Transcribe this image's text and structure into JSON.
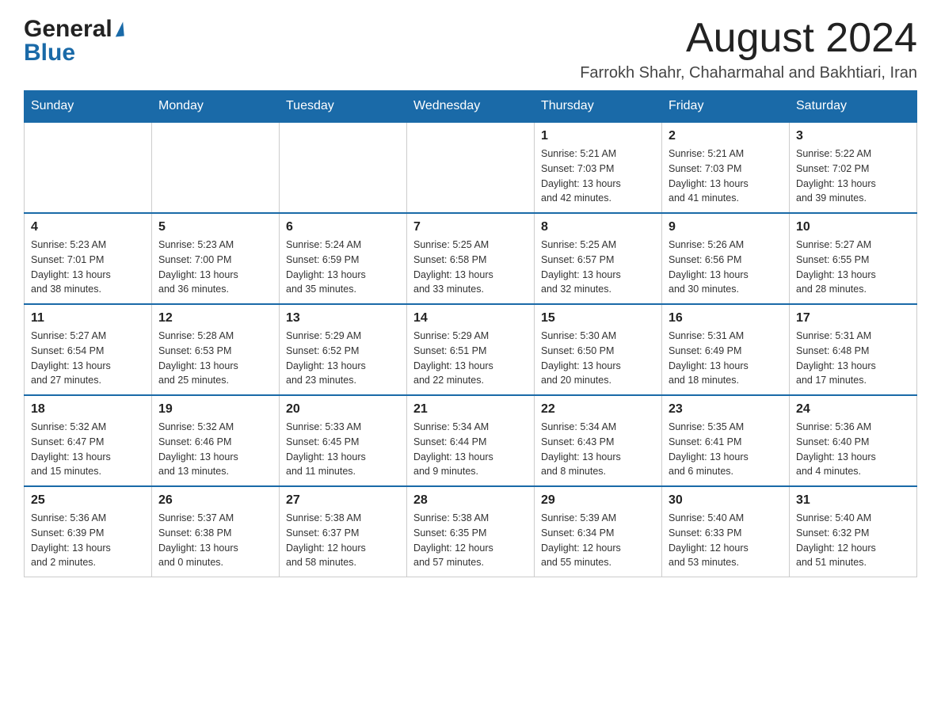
{
  "logo": {
    "general": "General",
    "blue": "Blue"
  },
  "title": "August 2024",
  "subtitle": "Farrokh Shahr, Chaharmahal and Bakhtiari, Iran",
  "days_of_week": [
    "Sunday",
    "Monday",
    "Tuesday",
    "Wednesday",
    "Thursday",
    "Friday",
    "Saturday"
  ],
  "weeks": [
    [
      {
        "day": "",
        "info": ""
      },
      {
        "day": "",
        "info": ""
      },
      {
        "day": "",
        "info": ""
      },
      {
        "day": "",
        "info": ""
      },
      {
        "day": "1",
        "info": "Sunrise: 5:21 AM\nSunset: 7:03 PM\nDaylight: 13 hours\nand 42 minutes."
      },
      {
        "day": "2",
        "info": "Sunrise: 5:21 AM\nSunset: 7:03 PM\nDaylight: 13 hours\nand 41 minutes."
      },
      {
        "day": "3",
        "info": "Sunrise: 5:22 AM\nSunset: 7:02 PM\nDaylight: 13 hours\nand 39 minutes."
      }
    ],
    [
      {
        "day": "4",
        "info": "Sunrise: 5:23 AM\nSunset: 7:01 PM\nDaylight: 13 hours\nand 38 minutes."
      },
      {
        "day": "5",
        "info": "Sunrise: 5:23 AM\nSunset: 7:00 PM\nDaylight: 13 hours\nand 36 minutes."
      },
      {
        "day": "6",
        "info": "Sunrise: 5:24 AM\nSunset: 6:59 PM\nDaylight: 13 hours\nand 35 minutes."
      },
      {
        "day": "7",
        "info": "Sunrise: 5:25 AM\nSunset: 6:58 PM\nDaylight: 13 hours\nand 33 minutes."
      },
      {
        "day": "8",
        "info": "Sunrise: 5:25 AM\nSunset: 6:57 PM\nDaylight: 13 hours\nand 32 minutes."
      },
      {
        "day": "9",
        "info": "Sunrise: 5:26 AM\nSunset: 6:56 PM\nDaylight: 13 hours\nand 30 minutes."
      },
      {
        "day": "10",
        "info": "Sunrise: 5:27 AM\nSunset: 6:55 PM\nDaylight: 13 hours\nand 28 minutes."
      }
    ],
    [
      {
        "day": "11",
        "info": "Sunrise: 5:27 AM\nSunset: 6:54 PM\nDaylight: 13 hours\nand 27 minutes."
      },
      {
        "day": "12",
        "info": "Sunrise: 5:28 AM\nSunset: 6:53 PM\nDaylight: 13 hours\nand 25 minutes."
      },
      {
        "day": "13",
        "info": "Sunrise: 5:29 AM\nSunset: 6:52 PM\nDaylight: 13 hours\nand 23 minutes."
      },
      {
        "day": "14",
        "info": "Sunrise: 5:29 AM\nSunset: 6:51 PM\nDaylight: 13 hours\nand 22 minutes."
      },
      {
        "day": "15",
        "info": "Sunrise: 5:30 AM\nSunset: 6:50 PM\nDaylight: 13 hours\nand 20 minutes."
      },
      {
        "day": "16",
        "info": "Sunrise: 5:31 AM\nSunset: 6:49 PM\nDaylight: 13 hours\nand 18 minutes."
      },
      {
        "day": "17",
        "info": "Sunrise: 5:31 AM\nSunset: 6:48 PM\nDaylight: 13 hours\nand 17 minutes."
      }
    ],
    [
      {
        "day": "18",
        "info": "Sunrise: 5:32 AM\nSunset: 6:47 PM\nDaylight: 13 hours\nand 15 minutes."
      },
      {
        "day": "19",
        "info": "Sunrise: 5:32 AM\nSunset: 6:46 PM\nDaylight: 13 hours\nand 13 minutes."
      },
      {
        "day": "20",
        "info": "Sunrise: 5:33 AM\nSunset: 6:45 PM\nDaylight: 13 hours\nand 11 minutes."
      },
      {
        "day": "21",
        "info": "Sunrise: 5:34 AM\nSunset: 6:44 PM\nDaylight: 13 hours\nand 9 minutes."
      },
      {
        "day": "22",
        "info": "Sunrise: 5:34 AM\nSunset: 6:43 PM\nDaylight: 13 hours\nand 8 minutes."
      },
      {
        "day": "23",
        "info": "Sunrise: 5:35 AM\nSunset: 6:41 PM\nDaylight: 13 hours\nand 6 minutes."
      },
      {
        "day": "24",
        "info": "Sunrise: 5:36 AM\nSunset: 6:40 PM\nDaylight: 13 hours\nand 4 minutes."
      }
    ],
    [
      {
        "day": "25",
        "info": "Sunrise: 5:36 AM\nSunset: 6:39 PM\nDaylight: 13 hours\nand 2 minutes."
      },
      {
        "day": "26",
        "info": "Sunrise: 5:37 AM\nSunset: 6:38 PM\nDaylight: 13 hours\nand 0 minutes."
      },
      {
        "day": "27",
        "info": "Sunrise: 5:38 AM\nSunset: 6:37 PM\nDaylight: 12 hours\nand 58 minutes."
      },
      {
        "day": "28",
        "info": "Sunrise: 5:38 AM\nSunset: 6:35 PM\nDaylight: 12 hours\nand 57 minutes."
      },
      {
        "day": "29",
        "info": "Sunrise: 5:39 AM\nSunset: 6:34 PM\nDaylight: 12 hours\nand 55 minutes."
      },
      {
        "day": "30",
        "info": "Sunrise: 5:40 AM\nSunset: 6:33 PM\nDaylight: 12 hours\nand 53 minutes."
      },
      {
        "day": "31",
        "info": "Sunrise: 5:40 AM\nSunset: 6:32 PM\nDaylight: 12 hours\nand 51 minutes."
      }
    ]
  ]
}
